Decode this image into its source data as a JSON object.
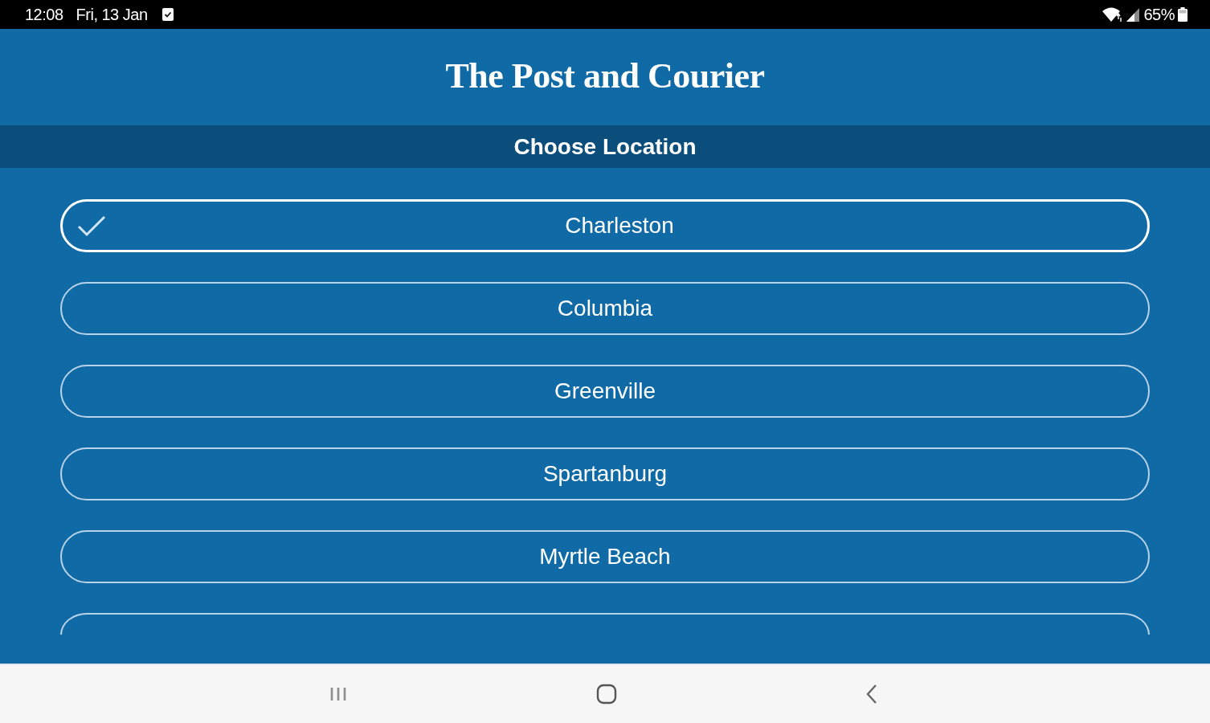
{
  "status_bar": {
    "time": "12:08",
    "date": "Fri, 13 Jan",
    "battery": "65%"
  },
  "header": {
    "logo": "The Post and Courier"
  },
  "section_title": "Choose Location",
  "locations": [
    {
      "kind": "full",
      "label": "Charleston",
      "selected": true
    },
    {
      "kind": "full",
      "label": "Columbia",
      "selected": false
    },
    {
      "kind": "full",
      "label": "Greenville",
      "selected": false
    },
    {
      "kind": "full",
      "label": "Spartanburg",
      "selected": false
    },
    {
      "kind": "full",
      "label": "Myrtle Beach",
      "selected": false
    },
    {
      "kind": "clipped",
      "selected": false
    }
  ]
}
